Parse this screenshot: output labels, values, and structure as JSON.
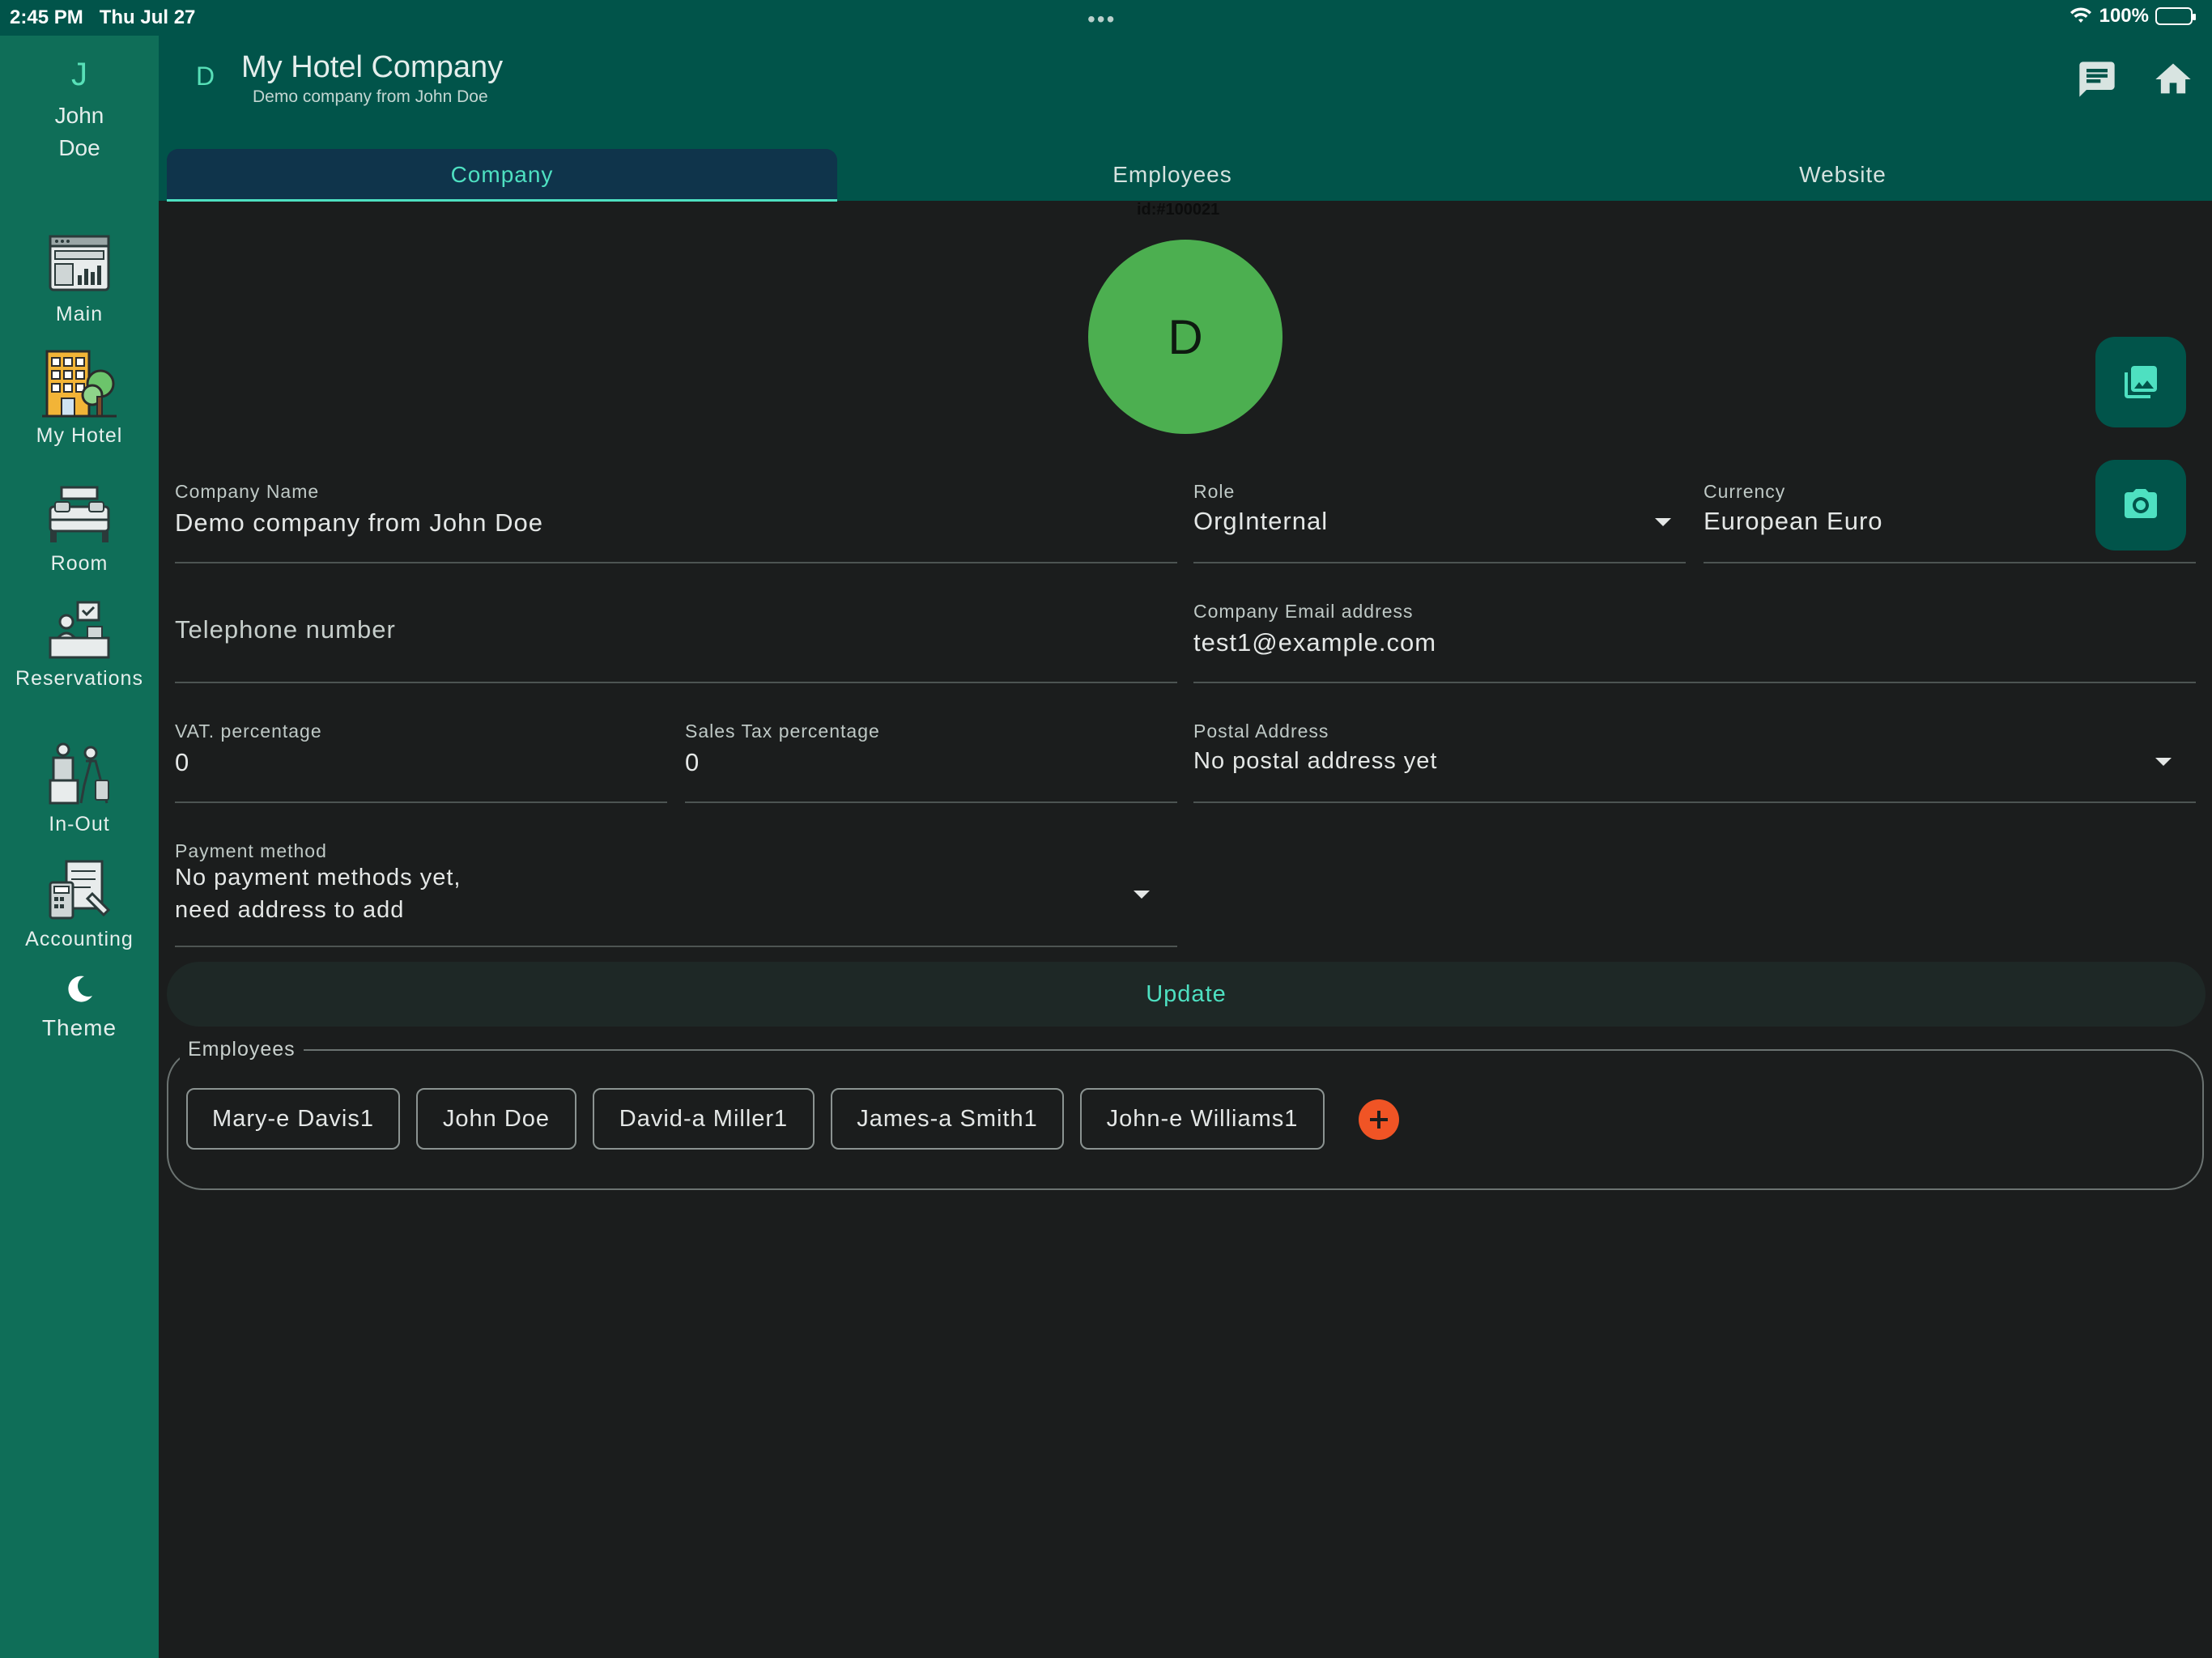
{
  "status_bar": {
    "time": "2:45 PM",
    "date": "Thu Jul 27",
    "battery": "100%"
  },
  "header": {
    "avatar_initial": "D",
    "title": "My Hotel Company",
    "subtitle": "Demo company from John Doe"
  },
  "tabs": [
    {
      "label": "Company",
      "active": true
    },
    {
      "label": "Employees",
      "active": false
    },
    {
      "label": "Website",
      "active": false
    }
  ],
  "sidebar": {
    "user_initial": "J",
    "user_name_first": "John",
    "user_name_last": "Doe",
    "items": [
      {
        "label": "Main",
        "icon": "dashboard-icon"
      },
      {
        "label": "My Hotel",
        "icon": "hotel-building-icon"
      },
      {
        "label": "Room",
        "icon": "room-bed-icon"
      },
      {
        "label": "Reservations",
        "icon": "reservations-desk-icon"
      },
      {
        "label": "In-Out",
        "icon": "checkin-luggage-icon"
      },
      {
        "label": "Accounting",
        "icon": "accounting-calculator-icon"
      },
      {
        "label": "Theme",
        "icon": "moon-icon"
      }
    ]
  },
  "company": {
    "id_text": "id:#100021",
    "avatar_initial": "D",
    "fields": {
      "company_name": {
        "label": "Company Name",
        "value": "Demo company from John Doe"
      },
      "role": {
        "label": "Role",
        "value": "OrgInternal"
      },
      "currency": {
        "label": "Currency",
        "value": "European Euro"
      },
      "telephone": {
        "placeholder": "Telephone number"
      },
      "email": {
        "label": "Company Email address",
        "value": "test1@example.com"
      },
      "vat": {
        "label": "VAT. percentage",
        "value": "0"
      },
      "sales_tax": {
        "label": "Sales Tax percentage",
        "value": "0"
      },
      "postal_address": {
        "label": "Postal Address",
        "value": "No postal address yet"
      },
      "payment_method": {
        "label": "Payment method",
        "value_line1": "No payment methods yet,",
        "value_line2": "need address to add"
      }
    },
    "update_label": "Update"
  },
  "employees_section": {
    "legend": "Employees",
    "chips": [
      "Mary-e Davis1",
      "John Doe",
      "David-a Miller1",
      "James-a Smith1",
      "John-e Williams1"
    ]
  },
  "colors": {
    "header_bg": "#01544a",
    "sidebar_bg": "#0f6e58",
    "accent": "#4ee0c1",
    "avatar_green": "#4caf50",
    "add_orange": "#f05425"
  }
}
